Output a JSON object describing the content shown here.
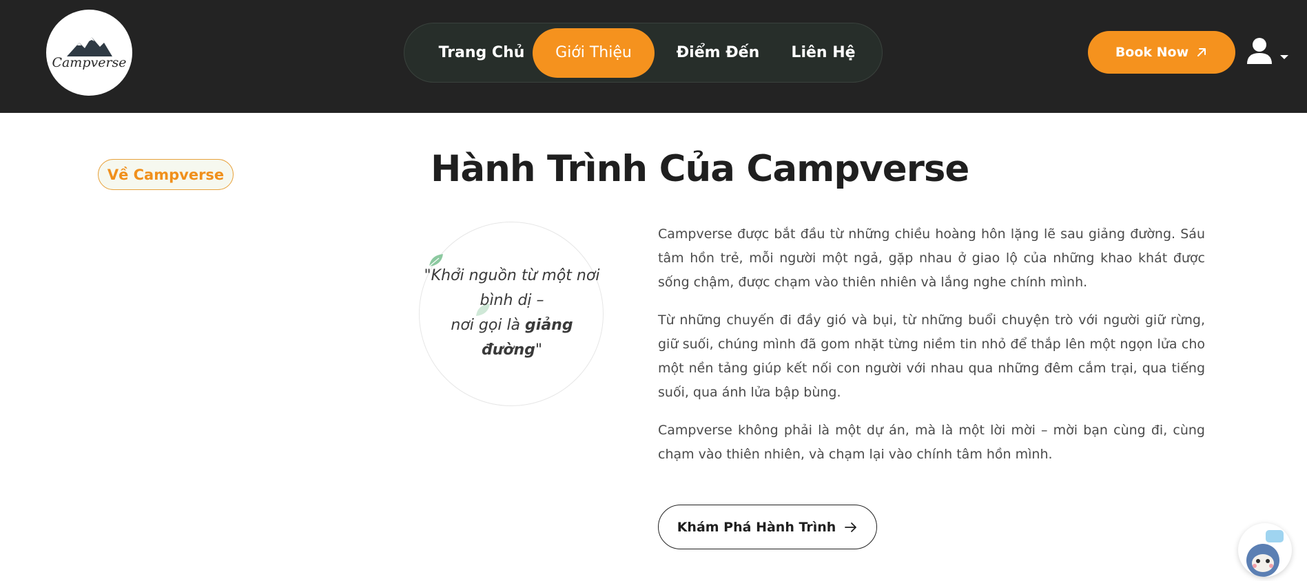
{
  "header": {
    "logo_text": "Campverse",
    "nav": [
      {
        "label": "Trang Chủ",
        "active": false
      },
      {
        "label": "Giới Thiệu",
        "active": true
      },
      {
        "label": "Điểm Đến",
        "active": false
      },
      {
        "label": "Liên Hệ",
        "active": false
      }
    ],
    "book_label": "Book Now",
    "book_icon": "arrow-up-right-icon",
    "user_icon": "user-icon"
  },
  "about": {
    "badge": "Về Campverse",
    "title": "Hành Trình Của Campverse",
    "quote": {
      "line1": "\"Khởi nguồn từ một nơi",
      "line2": "bình dị –",
      "line3_prefix": "nơi gọi là ",
      "line3_bold": "giảng",
      "line4_bold": "đường",
      "line4_suffix": "\""
    },
    "paragraphs": [
      "Campverse được bắt đầu từ những chiều hoàng hôn lặng lẽ sau giảng đường. Sáu tâm hồn trẻ, mỗi người một ngả, gặp nhau ở giao lộ của những khao khát được sống chậm, được chạm vào thiên nhiên và lắng nghe chính mình.",
      "Từ những chuyến đi đầy gió và bụi, từ những buổi chuyện trò với người giữ rừng, giữ suối, chúng mình đã gom nhặt từng niềm tin nhỏ để thắp lên một ngọn lửa cho một nền tảng giúp kết nối con người với nhau qua những đêm cắm trại, qua tiếng suối, qua ánh lửa bập bùng.",
      "Campverse không phải là một dự án, mà là một lời mời – mời bạn cùng đi, cùng chạm vào thiên nhiên, và chạm lại vào chính tâm hồn mình."
    ],
    "explore_label": "Khám Phá Hành Trình"
  },
  "colors": {
    "header_bg": "#232323",
    "accent": "#f5921e",
    "text": "#1f1f1f"
  }
}
